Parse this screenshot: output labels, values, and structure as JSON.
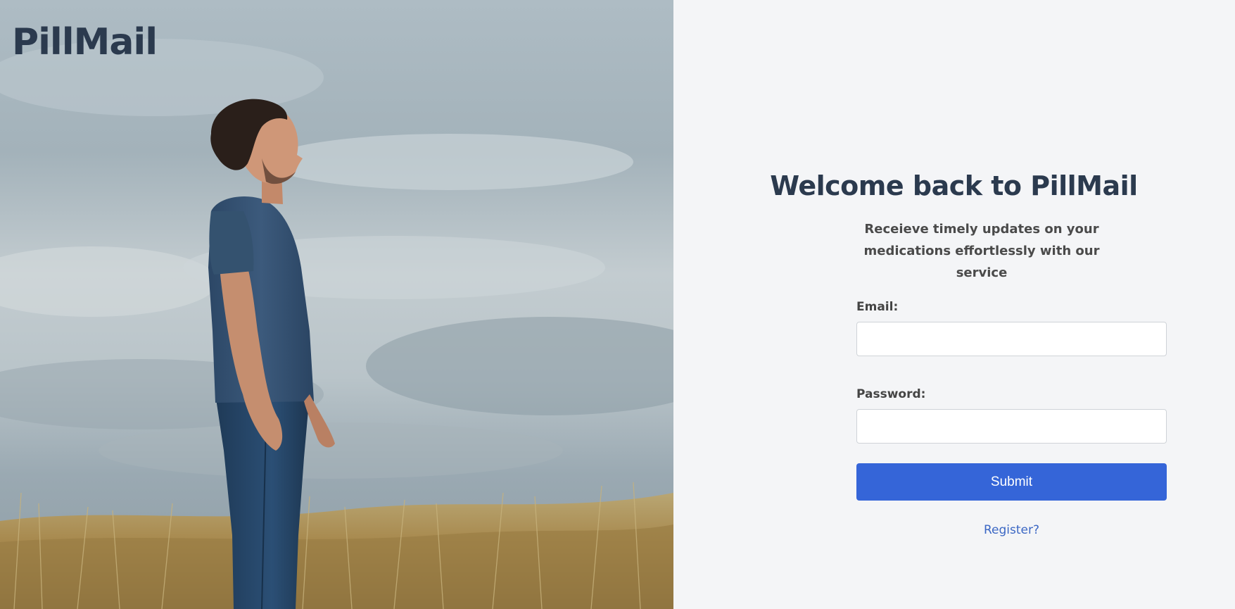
{
  "hero": {
    "brand": "PillMail",
    "photo": "man-in-field-photo"
  },
  "login": {
    "title": "Welcome back to PillMail",
    "subtitle": "Receieve timely updates on your medications effortlessly with our service",
    "email_label": "Email:",
    "email_value": "",
    "password_label": "Password:",
    "password_value": "",
    "submit_label": "Submit",
    "register_label": "Register?"
  },
  "colors": {
    "brand_text": "#2b3a4e",
    "button": "#3565d8",
    "link": "#3b67c4",
    "panel_bg": "#f4f5f7"
  }
}
